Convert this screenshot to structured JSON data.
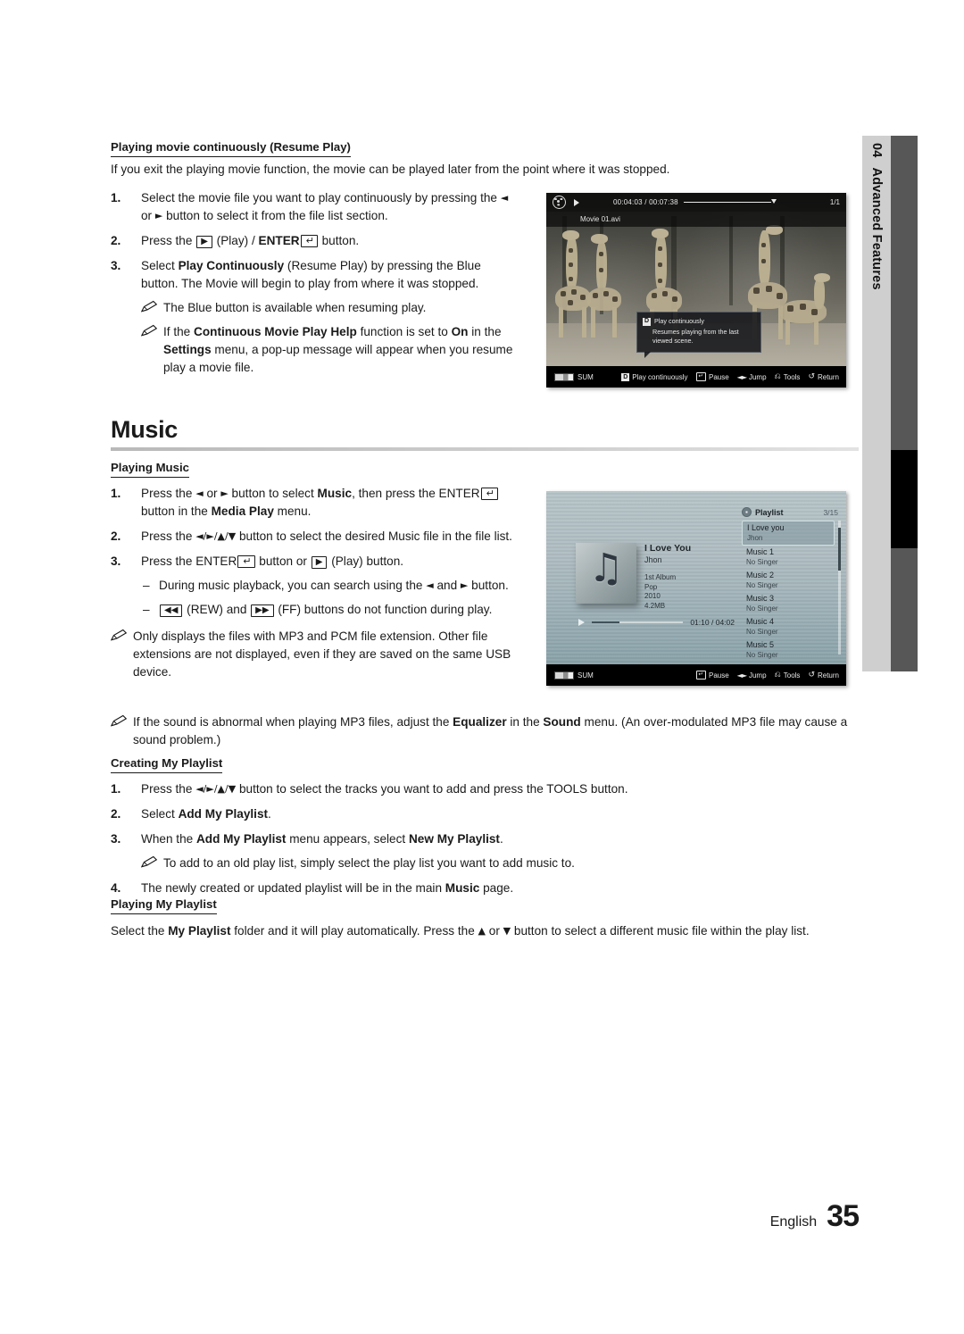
{
  "chapter_tab": {
    "number": "04",
    "label": "Advanced Features"
  },
  "section_resume": {
    "heading": "Playing movie continuously (Resume Play)",
    "intro": "If you exit the playing movie function, the movie can be played later from the point where it was stopped.",
    "steps": [
      {
        "num": "1.",
        "text_a": "Select the movie file you want to play continuously by pressing the ",
        "text_b": " or ",
        "text_c": " button to select it from the file list section."
      },
      {
        "num": "2.",
        "text_a": "Press the ",
        "text_b": " (Play) / ",
        "text_c": "ENTER",
        "text_d": " button."
      },
      {
        "num": "3.",
        "text_a": "Select ",
        "bold_a": "Play Continuously",
        "text_b": " (Resume Play) by pressing the Blue button. The Movie will begin to play from where it was stopped."
      }
    ],
    "notes": [
      {
        "text": "The Blue button is available when resuming play."
      },
      {
        "text_a": "If the ",
        "bold_a": "Continuous Movie Play Help",
        "text_b": " function is set to ",
        "bold_b": "On",
        "text_c": " in the ",
        "bold_c": "Settings",
        "text_d": " menu, a pop-up message will appear when you resume play a movie file."
      }
    ]
  },
  "music_heading": "Music",
  "section_playing_music": {
    "heading": "Playing Music",
    "steps": [
      {
        "num": "1.",
        "text_a": "Press the ",
        "text_b": " or ",
        "text_c": " button to select ",
        "bold_a": "Music",
        "text_d": ", then press the ",
        "text_e": "ENTER",
        "text_f": " button in the ",
        "bold_b": "Media Play",
        "text_g": " menu."
      },
      {
        "num": "2.",
        "text_a": "Press the ",
        "text_b": " button to select the desired Music file in the file list."
      },
      {
        "num": "3.",
        "text_a": "Press the ",
        "text_b": "ENTER",
        "text_c": " button or ",
        "text_d": " (Play) button."
      }
    ],
    "dashes": [
      {
        "text_a": "During music playback, you can search using the ",
        "text_b": " and ",
        "text_c": " button."
      },
      {
        "text_a": " (REW) and ",
        "text_b": " (FF) buttons do not function during play."
      }
    ],
    "note": "Only displays the files with MP3 and PCM file extension. Other file extensions are not displayed, even if they are saved on the same USB device."
  },
  "note_equalizer": {
    "text_a": "If the sound is abnormal when playing MP3 files, adjust the ",
    "bold_a": "Equalizer",
    "text_b": " in the ",
    "bold_b": "Sound",
    "text_c": " menu. (An over-modulated MP3 file may cause a sound problem.)"
  },
  "section_create_playlist": {
    "heading": "Creating My Playlist",
    "steps": [
      {
        "num": "1.",
        "text_a": "Press the ",
        "text_b": " button to select the tracks you want to add and press the ",
        "bold_a": "TOOLS",
        "text_c": " button."
      },
      {
        "num": "2.",
        "text_a": "Select ",
        "bold_a": "Add My Playlist",
        "text_b": "."
      },
      {
        "num": "3.",
        "text_a": "When the ",
        "bold_a": "Add My Playlist",
        "text_b": " menu appears, select ",
        "bold_b": "New My Playlist",
        "text_c": "."
      },
      {
        "num": "4.",
        "text_a": "The newly created or updated playlist will be in the main ",
        "bold_a": "Music",
        "text_b": " page."
      }
    ],
    "note": "To add to an old play list, simply select the play list you want to add music to."
  },
  "section_playing_playlist": {
    "heading": "Playing My Playlist",
    "text_a": "Select the ",
    "bold_a": "My Playlist",
    "text_b": " folder and it will play automatically. Press the ",
    "text_c": " or ",
    "text_d": " button to select a different music file within the play list."
  },
  "screenshot_movie": {
    "time_current": "00:04:03",
    "time_sep": "/",
    "time_total": "00:07:38",
    "page_counter": "1/1",
    "file_name": "Movie 01.avi",
    "tooltip": {
      "badge": "D",
      "title": "Play continuously",
      "desc": "Resumes playing from the last viewed scene."
    },
    "button_bar": {
      "source": "SUM",
      "items": [
        {
          "icon": "D",
          "label": "Play continuously"
        },
        {
          "icon": "enter",
          "label": "Pause"
        },
        {
          "icon": "left-right",
          "label": "Jump"
        },
        {
          "icon": "tools",
          "label": "Tools"
        },
        {
          "icon": "return",
          "label": "Return"
        }
      ]
    }
  },
  "screenshot_music": {
    "now_playing": {
      "title": "I Love You",
      "artist": "Jhon",
      "album": "1st Album",
      "genre": "Pop",
      "year": "2010",
      "size": "4.2MB",
      "time_elapsed": "01:10",
      "time_sep": "/",
      "time_total": "04:02"
    },
    "playlist": {
      "title": "Playlist",
      "counter": "3/15",
      "items": [
        {
          "name": "I Love you",
          "singer": "Jhon",
          "selected": true
        },
        {
          "name": "Music 1",
          "singer": "No Singer",
          "selected": false
        },
        {
          "name": "Music 2",
          "singer": "No Singer",
          "selected": false
        },
        {
          "name": "Music 3",
          "singer": "No Singer",
          "selected": false
        },
        {
          "name": "Music 4",
          "singer": "No Singer",
          "selected": false
        },
        {
          "name": "Music 5",
          "singer": "No Singer",
          "selected": false
        }
      ]
    },
    "button_bar": {
      "source": "SUM",
      "items": [
        {
          "icon": "enter",
          "label": "Pause"
        },
        {
          "icon": "left-right",
          "label": "Jump"
        },
        {
          "icon": "tools",
          "label": "Tools"
        },
        {
          "icon": "return",
          "label": "Return"
        }
      ]
    }
  },
  "footer": {
    "language": "English",
    "page": "35"
  }
}
